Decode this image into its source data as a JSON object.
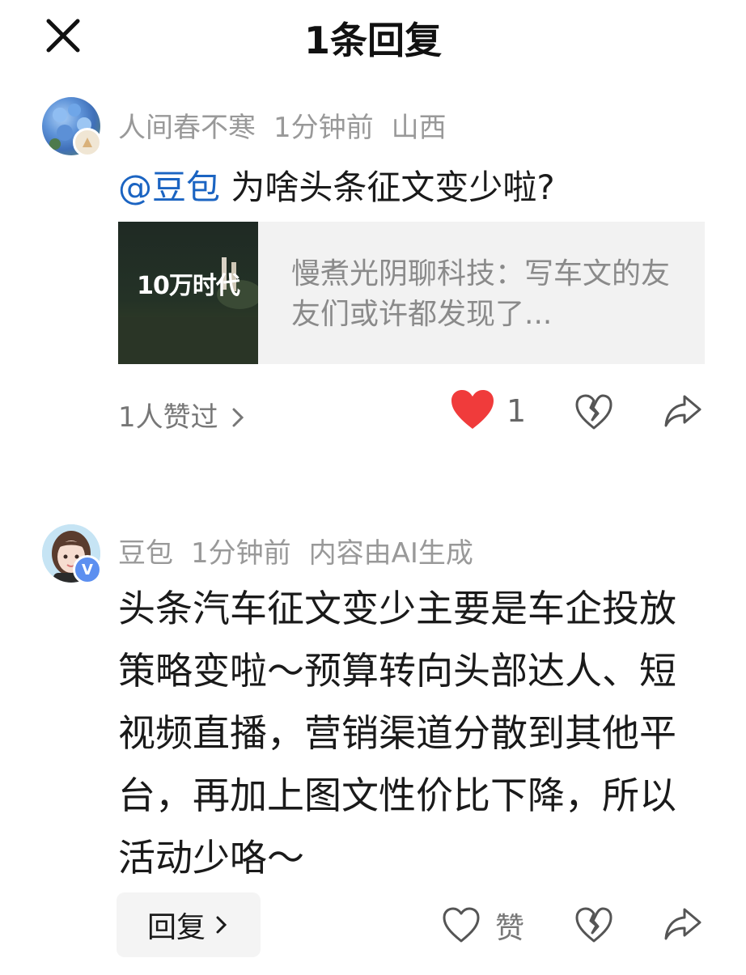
{
  "header": {
    "title": "1条回复"
  },
  "comment": {
    "username": "人间春不寒",
    "time": "1分钟前",
    "location": "山西",
    "mention": "@豆包",
    "text": " 为啥头条征文变少啦?",
    "link_card": {
      "thumb_text": "10万时代",
      "description": "慢煮光阴聊科技：写车文的友友们或许都发现了..."
    },
    "likes_summary": "1人赞过",
    "like_count": "1"
  },
  "reply": {
    "username": "豆包",
    "time": "1分钟前",
    "ai_notice": "内容由AI生成",
    "badge": "V",
    "text": "头条汽车征文变少主要是车企投放策略变啦～预算转向头部达人、短视频直播，营销渠道分散到其他平台，再加上图文性价比下降，所以活动少咯～",
    "reply_button": "回复",
    "like_label": "赞"
  },
  "colors": {
    "mention": "#1b64c2",
    "liked_heart": "#f03b3b",
    "meta_gray": "#999999"
  }
}
